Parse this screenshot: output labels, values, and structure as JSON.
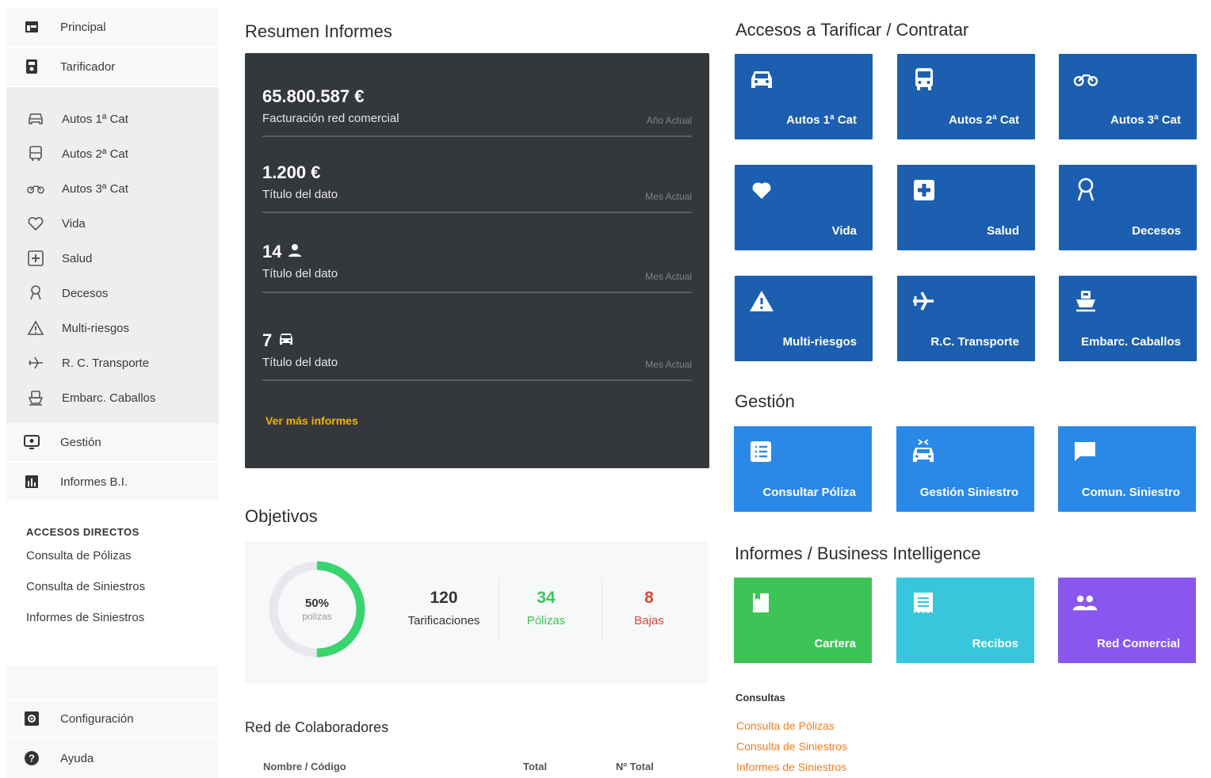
{
  "sidebar": {
    "top": [
      {
        "label": "Principal",
        "icon": "dashboard-icon"
      },
      {
        "label": "Tarificador",
        "icon": "calculator-icon"
      }
    ],
    "sub": [
      {
        "label": "Autos 1ª Cat",
        "icon": "car-icon"
      },
      {
        "label": "Autos 2ª Cat",
        "icon": "bus-icon"
      },
      {
        "label": "Autos 3ª Cat",
        "icon": "motorcycle-icon"
      },
      {
        "label": "Vida",
        "icon": "heart-icon"
      },
      {
        "label": "Salud",
        "icon": "medical-cross-icon"
      },
      {
        "label": "Decesos",
        "icon": "ribbon-icon"
      },
      {
        "label": "Multi-riesgos",
        "icon": "warning-icon"
      },
      {
        "label": "R. C. Transporte",
        "icon": "plane-icon"
      },
      {
        "label": "Embarc. Caballos",
        "icon": "ship-icon"
      }
    ],
    "mid": [
      {
        "label": "Gestión",
        "icon": "management-icon"
      },
      {
        "label": "Informes B.I.",
        "icon": "bar-chart-icon"
      }
    ],
    "shortcuts_header": "ACCESOS DIRECTOS",
    "shortcuts": [
      "Consulta de Pólizas",
      "Consulta de Siniestros",
      "Informes de Siniestros"
    ],
    "bottom": [
      {
        "label": "Configuración",
        "icon": "settings-icon"
      },
      {
        "label": "Ayuda",
        "icon": "help-icon"
      }
    ]
  },
  "summary": {
    "title": "Resumen Informes",
    "stats": [
      {
        "value": "65.800.587 €",
        "label": "Facturación red comercial",
        "period": "Año Actual"
      },
      {
        "value": "1.200 €",
        "label": "Título del dato",
        "period": "Mes Actual"
      },
      {
        "value": "14",
        "label": "Título del dato",
        "period": "Mes Actual",
        "icon": "user-icon"
      },
      {
        "value": "7",
        "label": "Título del dato",
        "period": "Mes Actual",
        "icon": "car-icon"
      }
    ],
    "more_link": "Ver más informes"
  },
  "objectives": {
    "title": "Objetivos",
    "ring_percent": "50%",
    "ring_fraction": 0.5,
    "ring_label": "polizas",
    "kpis": [
      {
        "value": "120",
        "label": "Tarificaciones",
        "color": "#333333"
      },
      {
        "value": "34",
        "label": "Pólizas",
        "color": "#3cc556"
      },
      {
        "value": "8",
        "label": "Bajas",
        "color": "#e0463a"
      }
    ]
  },
  "network": {
    "title": "Red de Colaboradores",
    "columns": [
      "Nombre / Código",
      "Total",
      "Nº Total"
    ]
  },
  "access": {
    "title": "Accesos a Tarificar / Contratar",
    "tiles": [
      {
        "label": "Autos 1ª Cat",
        "icon": "car-icon"
      },
      {
        "label": "Autos 2ª Cat",
        "icon": "bus-icon"
      },
      {
        "label": "Autos 3ª Cat",
        "icon": "motorcycle-icon"
      },
      {
        "label": "Vida",
        "icon": "heart-icon"
      },
      {
        "label": "Salud",
        "icon": "medical-cross-icon"
      },
      {
        "label": "Decesos",
        "icon": "ribbon-icon"
      },
      {
        "label": "Multi-riesgos",
        "icon": "warning-icon"
      },
      {
        "label": "R.C. Transporte",
        "icon": "plane-icon"
      },
      {
        "label": "Embarc. Caballos",
        "icon": "ship-icon"
      }
    ]
  },
  "management": {
    "title": "Gestión",
    "tiles": [
      {
        "label": "Consultar Póliza",
        "icon": "list-icon"
      },
      {
        "label": "Gestión Siniestro",
        "icon": "car-crash-icon"
      },
      {
        "label": "Comun. Siniestro",
        "icon": "chat-icon"
      }
    ]
  },
  "reports": {
    "title": "Informes / Business Intelligence",
    "tiles": [
      {
        "label": "Cartera",
        "icon": "bookmark-icon"
      },
      {
        "label": "Recibos",
        "icon": "receipt-icon"
      },
      {
        "label": "Red Comercial",
        "icon": "users-icon"
      }
    ]
  },
  "consultas": {
    "title": "Consultas",
    "links": [
      "Consulta de Pólizas",
      "Consulta de Siniestros",
      "Informes de Siniestros"
    ]
  },
  "colors": {
    "dark_blue": "#1c5fb0",
    "light_blue": "#2a89e8",
    "green": "#3cc556",
    "cyan": "#38c6dc",
    "purple": "#8957ef",
    "panel_dark": "#34373c",
    "link_orange": "#ef7d1e",
    "link_yellow": "#f4b400"
  }
}
